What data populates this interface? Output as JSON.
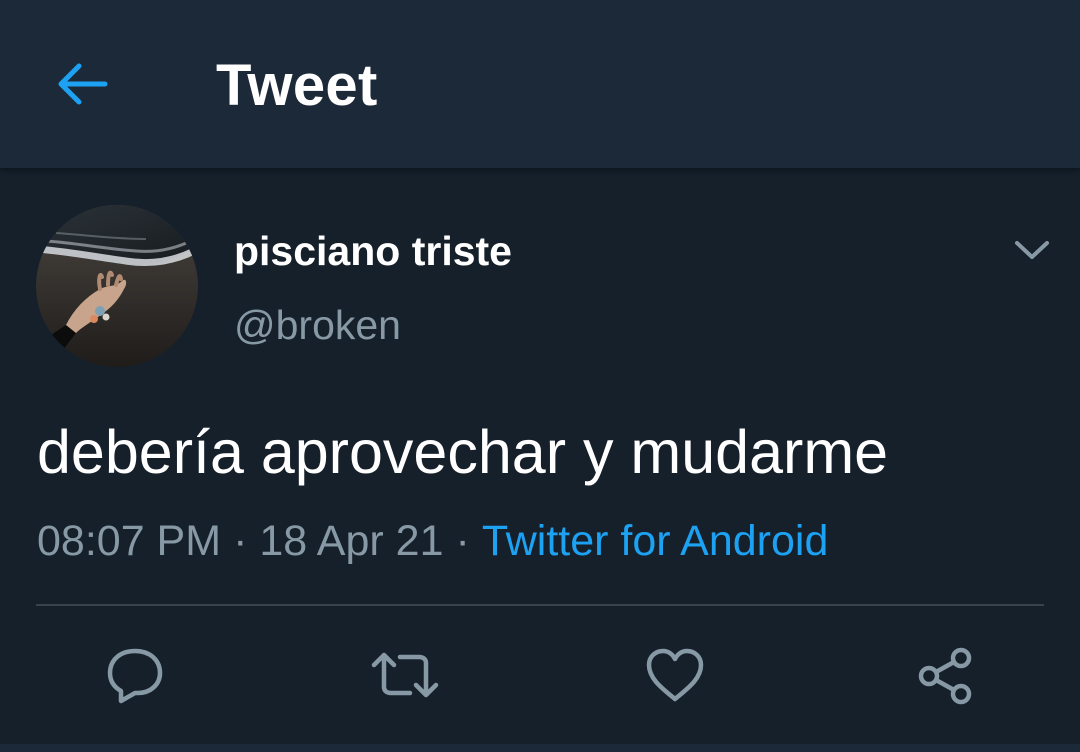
{
  "header": {
    "title": "Tweet",
    "back_icon": "back-arrow-icon"
  },
  "tweet": {
    "author": {
      "display_name": "pisciano triste",
      "handle": "@broken"
    },
    "text": "debería aprovechar y mudarme",
    "time": "08:07 PM",
    "date": "18 Apr 21",
    "separator": "·",
    "source": "Twitter for Android"
  },
  "actions": [
    {
      "icon": "reply-icon"
    },
    {
      "icon": "retweet-icon"
    },
    {
      "icon": "like-icon"
    },
    {
      "icon": "share-icon"
    }
  ],
  "colors": {
    "background": "#15202b",
    "header_background": "#1c2938",
    "accent": "#1da1f2",
    "secondary_text": "#8899a6",
    "divider": "#38444d"
  }
}
